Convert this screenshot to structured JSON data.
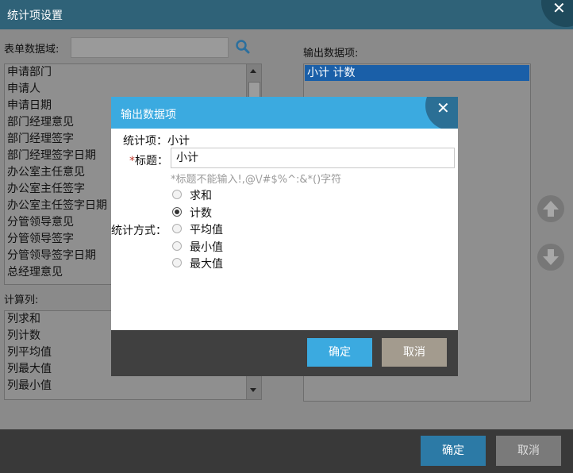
{
  "window": {
    "title": "统计项设置",
    "close_glyph": "✕",
    "ok_label": "确定",
    "cancel_label": "取消"
  },
  "form_domain": {
    "label": "表单数据域:",
    "search_value": "",
    "search_icon": "search-icon",
    "items": [
      "申请部门",
      "申请人",
      "申请日期",
      "部门经理意见",
      "部门经理签字",
      "部门经理签字日期",
      "办公室主任意见",
      "办公室主任签字",
      "办公室主任签字日期",
      "分管领导意见",
      "分管领导签字",
      "分管领导签字日期",
      "总经理意见"
    ]
  },
  "calc_columns": {
    "label": "计算列:",
    "items": [
      "列求和",
      "列计数",
      "列平均值",
      "列最大值",
      "列最小值"
    ]
  },
  "output": {
    "label": "输出数据项:",
    "items": [
      "小计 计数"
    ],
    "move_up_icon": "arrow-up-circle-icon",
    "move_down_icon": "arrow-down-circle-icon"
  },
  "dialog": {
    "title": "输出数据项",
    "close_glyph": "✕",
    "stat_item_label": "统计项：小计",
    "required_mark": "*",
    "title_label": "标题：",
    "title_value": "小计",
    "hint": "*标题不能输入!,@\\/#$%^:&*()字符",
    "method_label": "统计方式：",
    "methods": [
      {
        "label": "求和",
        "checked": false
      },
      {
        "label": "计数",
        "checked": true
      },
      {
        "label": "平均值",
        "checked": false
      },
      {
        "label": "最小值",
        "checked": false
      },
      {
        "label": "最大值",
        "checked": false
      }
    ],
    "ok_label": "确定",
    "cancel_label": "取消"
  }
}
